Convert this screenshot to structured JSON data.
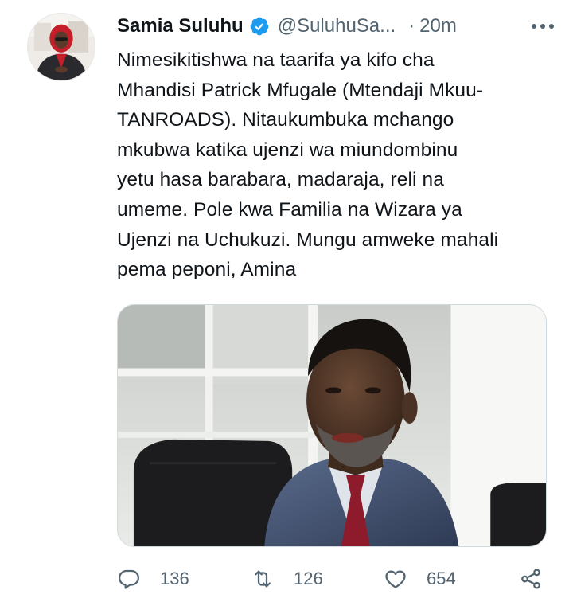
{
  "tweet": {
    "author_name": "Samia Suluhu",
    "handle": "@SuluhuSa...",
    "separator": "·",
    "time": "20m",
    "verified": true,
    "text_lines": [
      "Nimesikitishwa na taarifa ya kifo cha",
      "Mhandisi Patrick Mfugale (Mtendaji Mkuu-",
      "TANROADS). Nitaukumbuka mchango",
      "mkubwa katika ujenzi wa miundombinu",
      "yetu hasa barabara, madaraja, reli na",
      "umeme. Pole kwa Familia na Wizara ya",
      "Ujenzi na Uchukuzi. Mungu amweke mahali",
      "pema peponi, Amina"
    ],
    "media_description": "photo",
    "actions": {
      "reply_count": "136",
      "retweet_count": "126",
      "like_count": "654"
    }
  },
  "icons": {
    "verified": "verified-badge-icon",
    "more": "more-options-icon",
    "reply": "reply-icon",
    "retweet": "retweet-icon",
    "like": "heart-icon",
    "share": "share-icon"
  },
  "colors": {
    "verified_blue": "#1d9bf0",
    "secondary_text": "#536471",
    "primary_text": "#0f1419"
  }
}
